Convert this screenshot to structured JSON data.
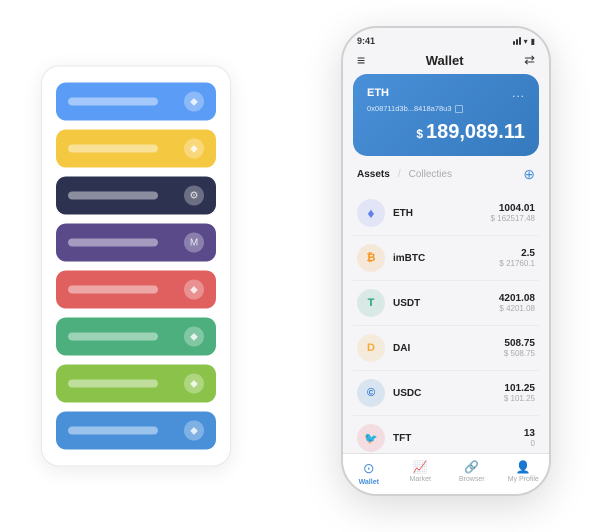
{
  "scene": {
    "card_stack": {
      "items": [
        {
          "id": "card-1",
          "color": "card-blue",
          "icon": "◆"
        },
        {
          "id": "card-2",
          "color": "card-yellow",
          "icon": "◆"
        },
        {
          "id": "card-3",
          "color": "card-dark",
          "icon": "⚙"
        },
        {
          "id": "card-4",
          "color": "card-purple",
          "icon": "M"
        },
        {
          "id": "card-5",
          "color": "card-red",
          "icon": "◆"
        },
        {
          "id": "card-6",
          "color": "card-green",
          "icon": "◆"
        },
        {
          "id": "card-7",
          "color": "card-lime",
          "icon": "◆"
        },
        {
          "id": "card-8",
          "color": "card-blue2",
          "icon": "◆"
        }
      ]
    },
    "phone": {
      "status_bar": {
        "time": "9:41",
        "icons": [
          "signal",
          "wifi",
          "battery"
        ]
      },
      "header": {
        "menu_icon": "≡",
        "title": "Wallet",
        "scan_icon": "⇄"
      },
      "eth_card": {
        "symbol": "ETH",
        "more_icon": "...",
        "address": "0x08711d3b...8418a78u3",
        "copy_icon": "⊡",
        "currency_symbol": "$",
        "balance": "189,089.11"
      },
      "assets_section": {
        "tab_active": "Assets",
        "tab_separator": "/",
        "tab_inactive": "Collecties",
        "add_icon": "⊕",
        "assets": [
          {
            "id": "eth",
            "icon": "♦",
            "icon_class": "icon-eth",
            "name": "ETH",
            "amount": "1004.01",
            "usd": "$ 162517.48"
          },
          {
            "id": "imbtc",
            "icon": "₿",
            "icon_class": "icon-imbtc",
            "name": "imBTC",
            "amount": "2.5",
            "usd": "$ 21760.1"
          },
          {
            "id": "usdt",
            "icon": "T",
            "icon_class": "icon-usdt",
            "name": "USDT",
            "amount": "4201.08",
            "usd": "$ 4201.08"
          },
          {
            "id": "dai",
            "icon": "D",
            "icon_class": "icon-dai",
            "name": "DAI",
            "amount": "508.75",
            "usd": "$ 508.75"
          },
          {
            "id": "usdc",
            "icon": "©",
            "icon_class": "icon-usdc",
            "name": "USDC",
            "amount": "101.25",
            "usd": "$ 101.25"
          },
          {
            "id": "tft",
            "icon": "🐦",
            "icon_class": "icon-tft",
            "name": "TFT",
            "amount": "13",
            "usd": "0"
          }
        ]
      },
      "bottom_nav": [
        {
          "id": "wallet",
          "icon": "⊙",
          "label": "Wallet",
          "active": true
        },
        {
          "id": "market",
          "icon": "📊",
          "label": "Market",
          "active": false
        },
        {
          "id": "browser",
          "icon": "👤",
          "label": "Browser",
          "active": false
        },
        {
          "id": "profile",
          "icon": "👤",
          "label": "My Profile",
          "active": false
        }
      ]
    }
  }
}
